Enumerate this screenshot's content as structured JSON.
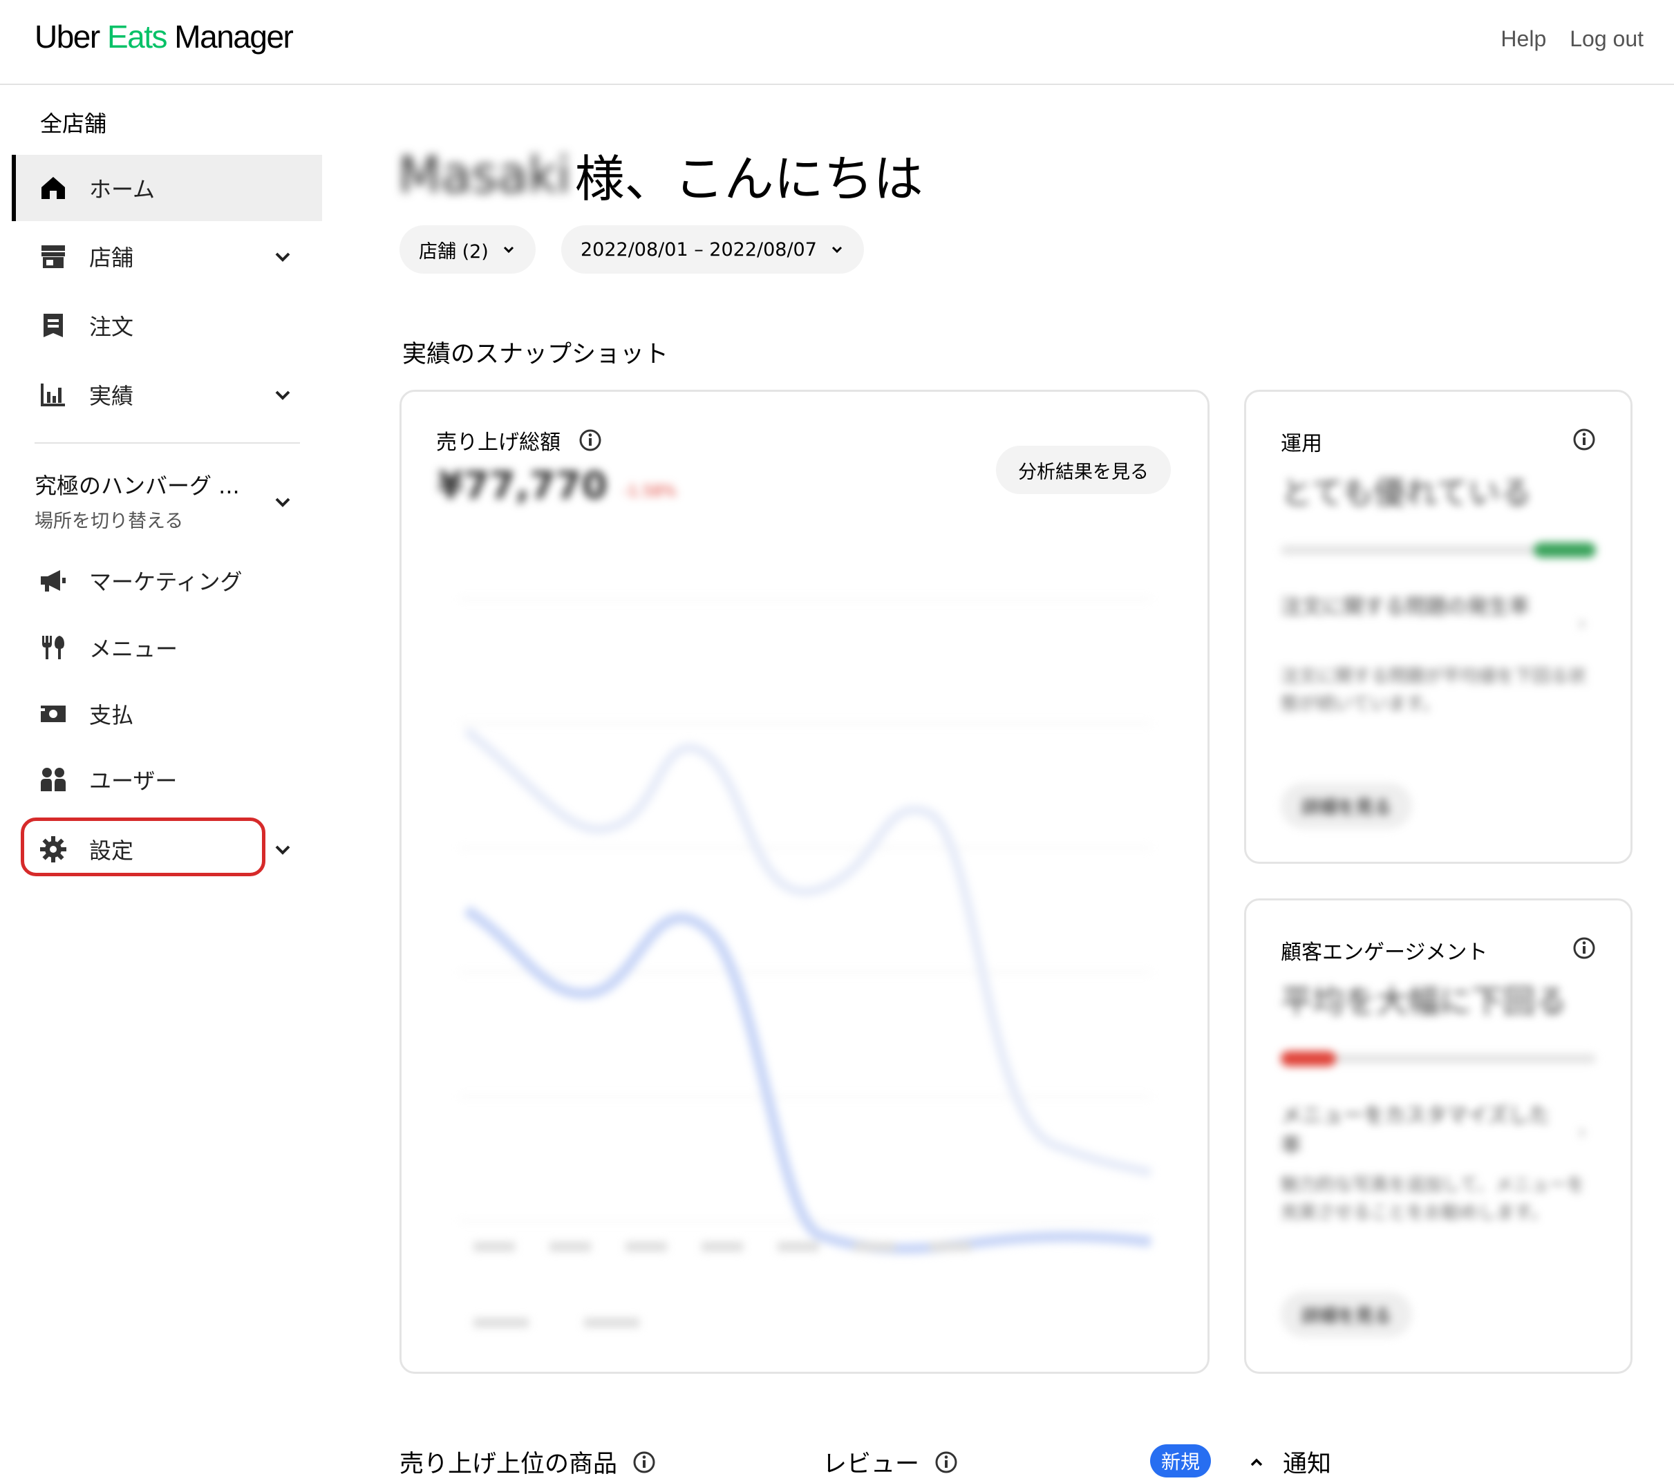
{
  "header": {
    "logo_prefix": "Uber ",
    "logo_eats": "Eats",
    "logo_suffix": " Manager",
    "help": "Help",
    "logout": "Log out"
  },
  "sidebar": {
    "scope": "全店舗",
    "items": [
      {
        "label": "ホーム",
        "icon": "home-icon"
      },
      {
        "label": "店舗",
        "icon": "store-icon"
      },
      {
        "label": "注文",
        "icon": "receipt-icon"
      },
      {
        "label": "実績",
        "icon": "bar-chart-icon"
      }
    ],
    "store_switch": {
      "name": "究極のハンバーグ ...",
      "sub": "場所を切り替える"
    },
    "store_items": [
      {
        "label": "マーケティング",
        "icon": "megaphone-icon"
      },
      {
        "label": "メニュー",
        "icon": "utensils-icon"
      },
      {
        "label": "支払",
        "icon": "payment-icon"
      },
      {
        "label": "ユーザー",
        "icon": "users-icon"
      },
      {
        "label": "設定",
        "icon": "gear-icon"
      }
    ]
  },
  "main": {
    "greeting_name": "Masaki",
    "greeting_text": "様、こんにちは",
    "filters": {
      "stores": "店舗 (2)",
      "date_range": "2022/08/01 – 2022/08/07"
    },
    "snapshot_title": "実績のスナップショット",
    "sales_card": {
      "title": "売り上げ総額",
      "value": "¥77,770",
      "change": "-1.58%",
      "analysis_button": "分析結果を見る"
    },
    "operations_card": {
      "title": "運用",
      "status": "とても優れている",
      "body_1": "注文に関する問題の発生率",
      "body_2": "注文に関する問題が平均値を下回る状態が続いています。",
      "link": "詳細を見る"
    },
    "engagement_card": {
      "title": "顧客エンゲージメント",
      "status": "平均を大幅に下回る",
      "body_1": "メニューをカスタマイズした率",
      "body_2": "魅力的な写真を追加して、メニューを充実させることをお勧めします。",
      "link": "詳細を見る"
    },
    "bottom": {
      "top_items": "売り上げ上位の商品",
      "reviews": "レビュー",
      "new_badge": "新規",
      "notifications": "通知"
    }
  },
  "colors": {
    "brand_green": "#06c167",
    "highlight_red": "#d62a2a",
    "badge_blue": "#276ef1",
    "status_green": "#3aa35b",
    "status_red": "#e0443a",
    "chart_line": "#c9d6f7"
  }
}
